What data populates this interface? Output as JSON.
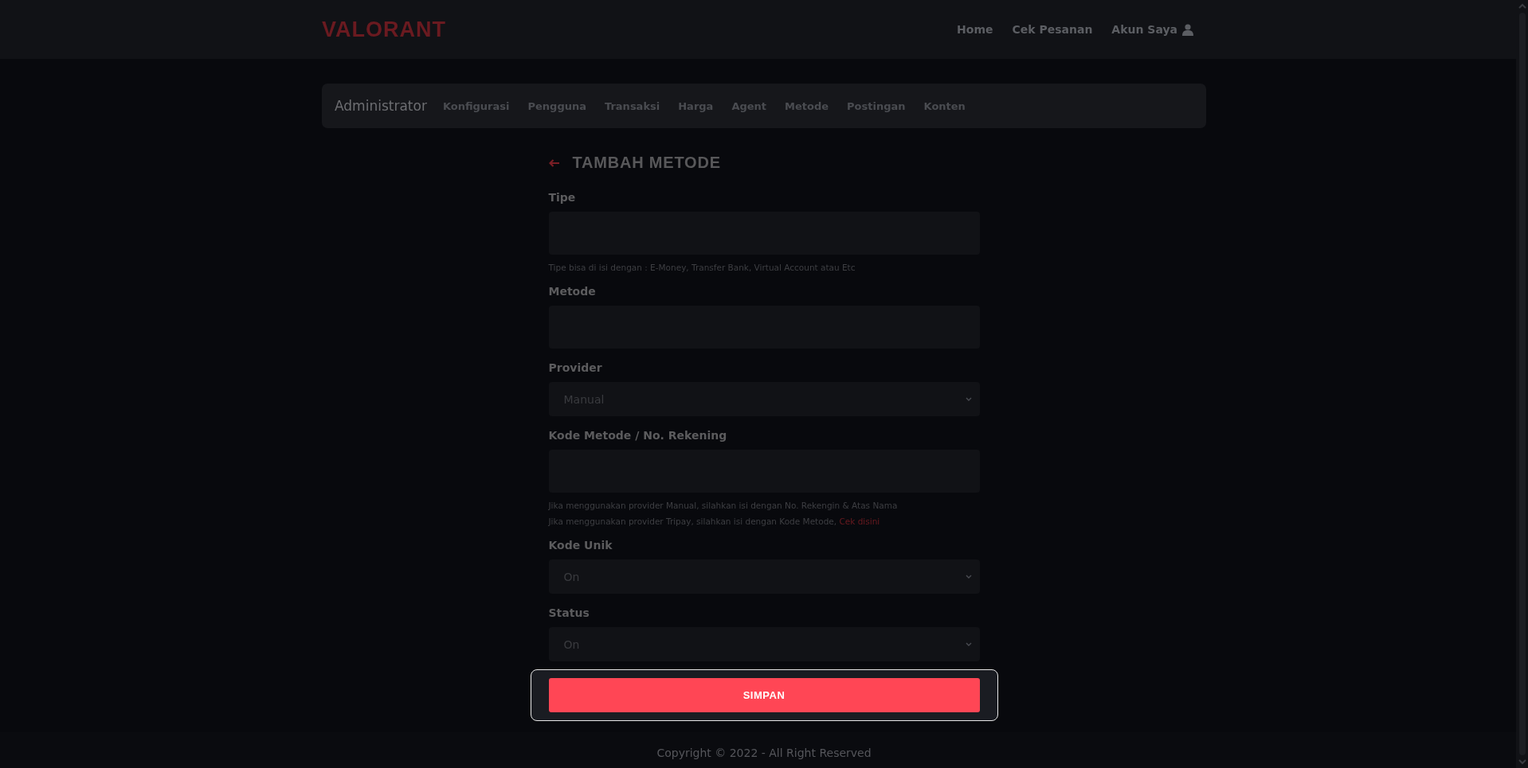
{
  "header": {
    "logo": "VALORANT",
    "nav": [
      {
        "label": "Home",
        "kind": "link"
      },
      {
        "label": "Cek Pesanan",
        "kind": "link"
      },
      {
        "label": "Akun Saya",
        "kind": "account"
      }
    ]
  },
  "admin_nav": {
    "title": "Administrator",
    "items": [
      "Konfigurasi",
      "Pengguna",
      "Transaksi",
      "Harga",
      "Agent",
      "Metode",
      "Postingan",
      "Konten"
    ]
  },
  "form": {
    "title": "TAMBAH METODE",
    "fields": [
      {
        "label": "Tipe",
        "kind": "input",
        "help": [
          {
            "text": "Tipe bisa di isi dengan : E-Money, Transfer Bank, Virtual Account atau Etc"
          }
        ]
      },
      {
        "label": "Metode",
        "kind": "input"
      },
      {
        "label": "Provider",
        "kind": "select",
        "value": "Manual"
      },
      {
        "label": "Kode Metode / No. Rekening",
        "kind": "input",
        "help": [
          {
            "text": "Jika menggunakan provider Manual, silahkan isi dengan No. Rekengin & Atas Nama"
          },
          {
            "text": "Jika menggunakan provider Tripay, silahkan isi dengan Kode Metode, ",
            "link": "Cek disini"
          }
        ]
      },
      {
        "label": "Kode Unik",
        "kind": "select",
        "value": "On"
      },
      {
        "label": "Status",
        "kind": "select",
        "value": "On"
      }
    ],
    "submit": {
      "label": "SIMPAN",
      "highlighted": true
    }
  },
  "footer": {
    "text": "Copyright © 2022 - All Right Reserved"
  }
}
